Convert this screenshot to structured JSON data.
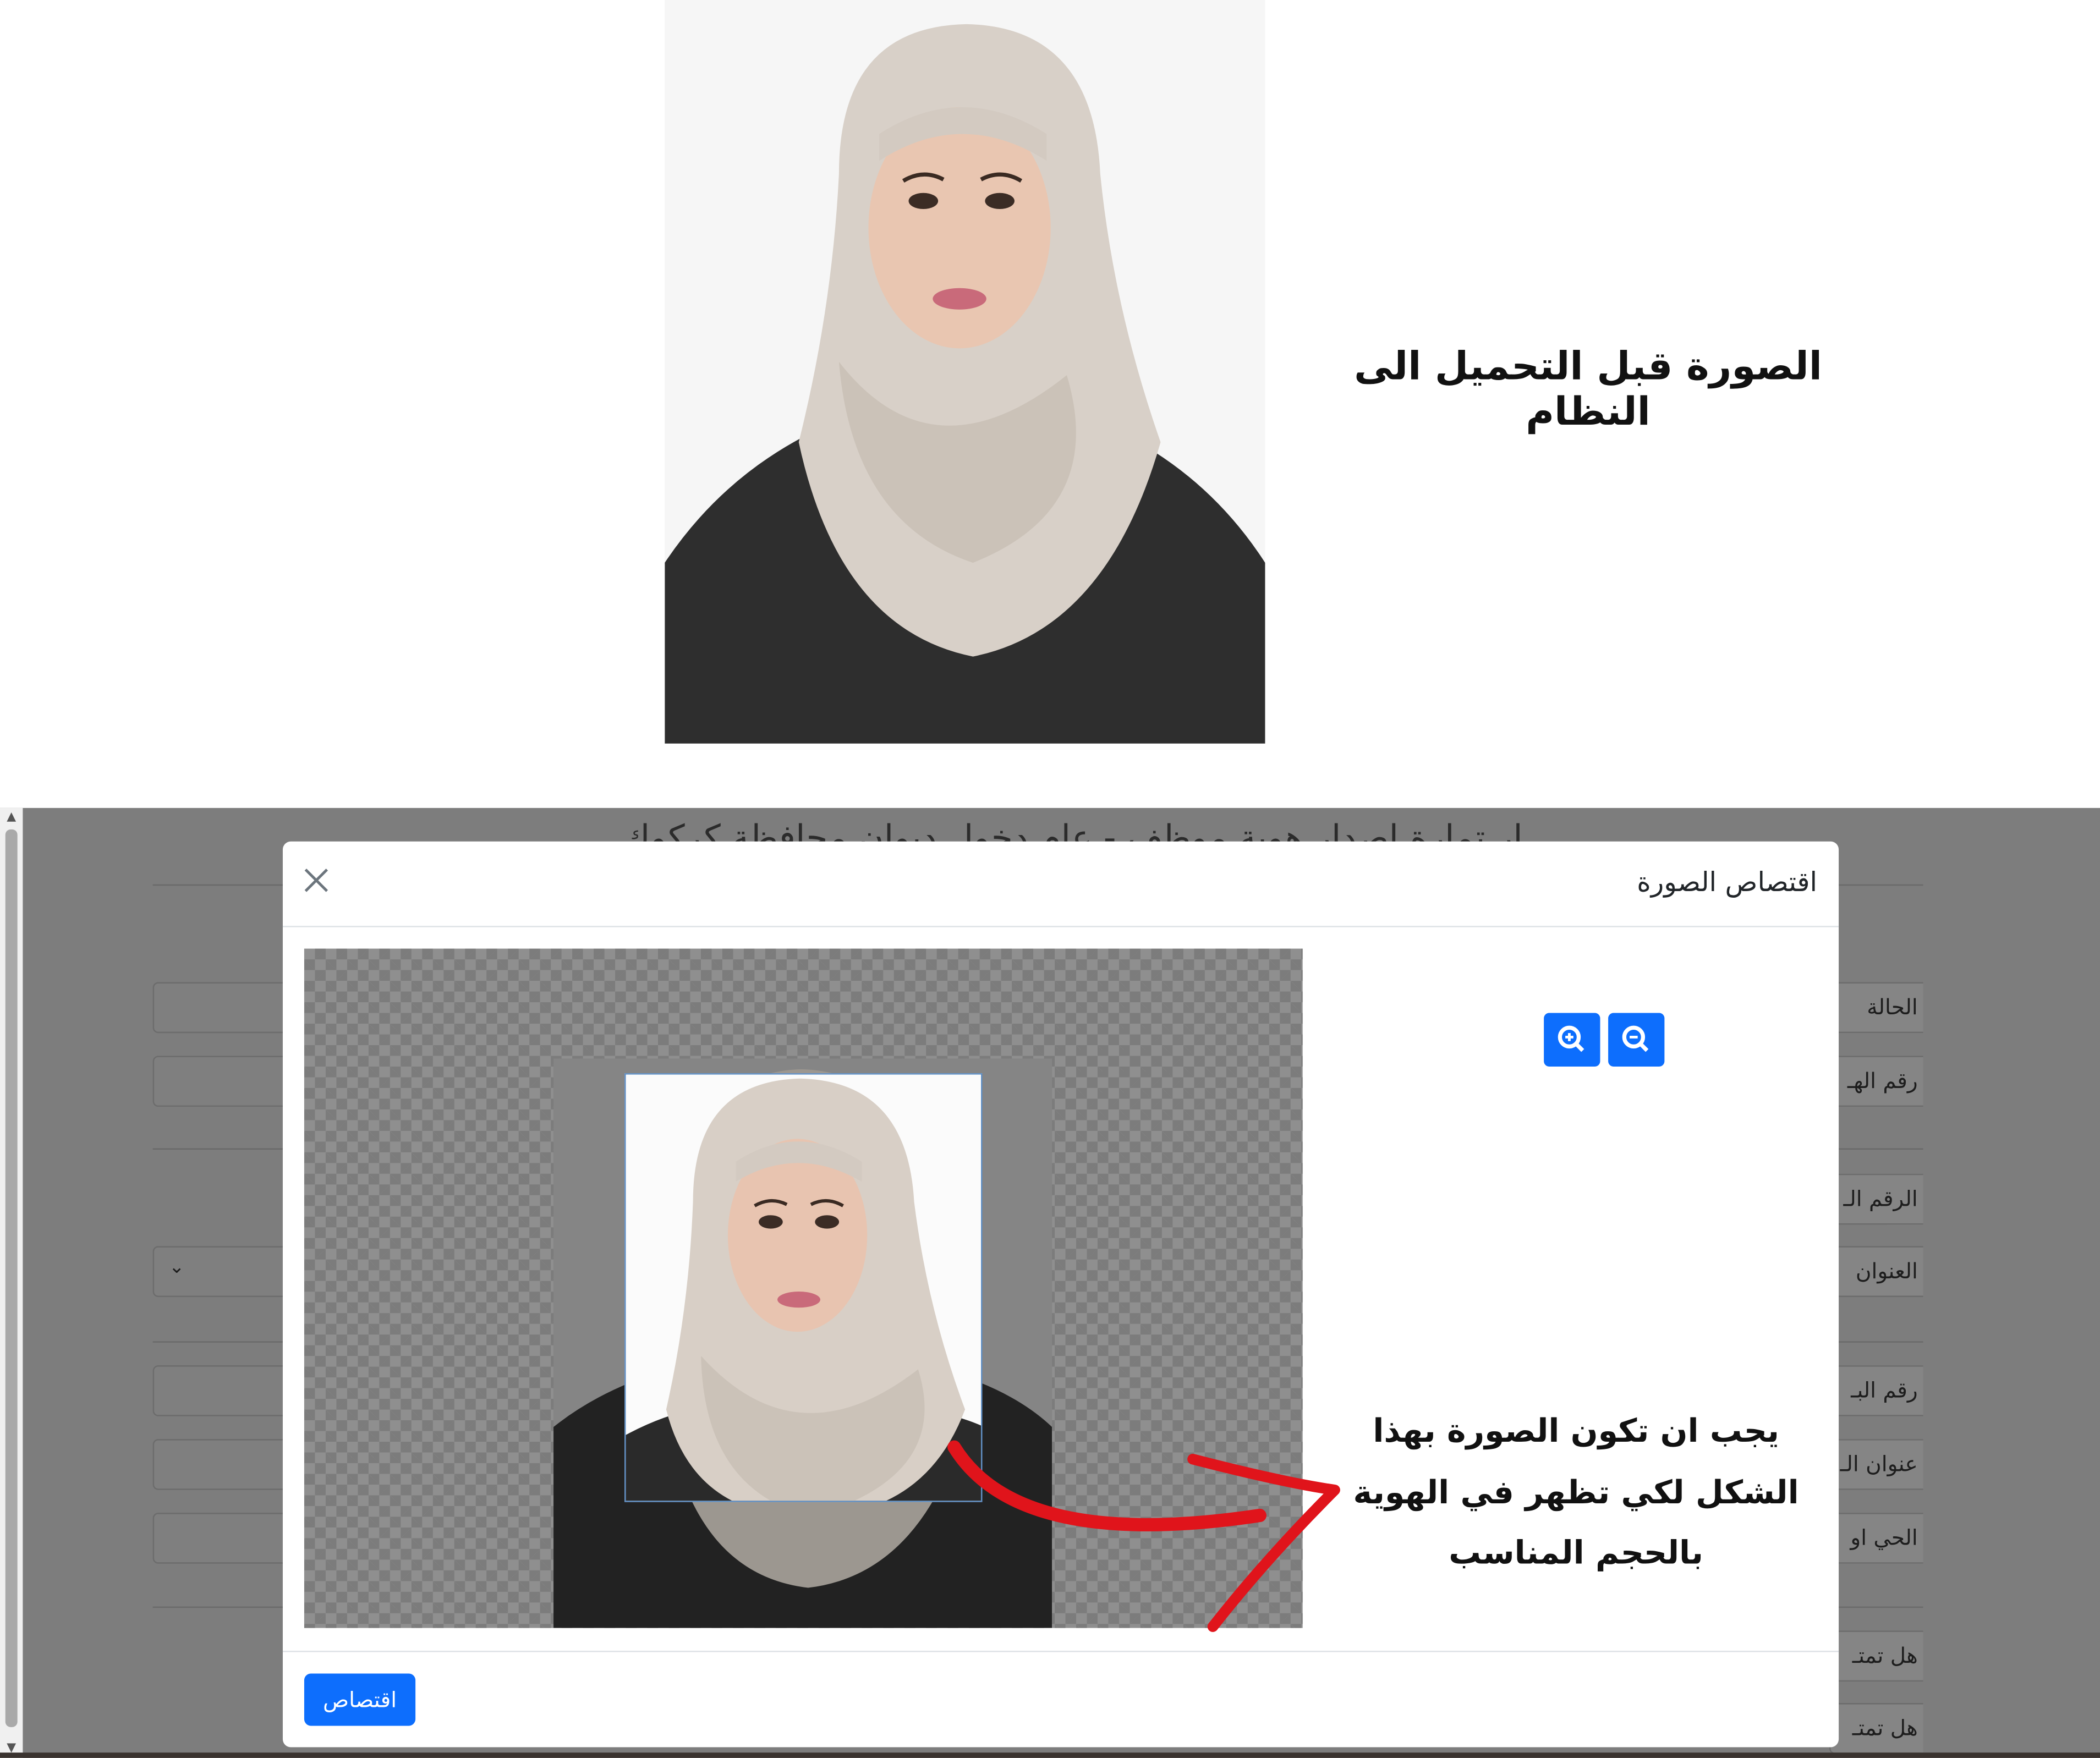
{
  "tutorial": {
    "caption_before": "الصورة قبل التحميل الى النظام"
  },
  "background_page": {
    "title": "ار تمارة اصدار هوية موظف - عام دخول ديوان محافظة كركوك",
    "labels": [
      "الحالة",
      "رقم الهـ",
      "الرقم الـ",
      "العنوان",
      "رقم البـ",
      "عنوان الـ",
      "الحي او",
      "هل تمتـ",
      "هل تمتـ"
    ]
  },
  "modal": {
    "title": "اقتصاص الصورة",
    "close_icon": "close-icon",
    "zoom_in_icon": "zoom-in-icon",
    "zoom_out_icon": "zoom-out-icon",
    "crop_button": "اقتصاص"
  },
  "annotation": {
    "instruction": "يجب ان تكون الصورة بهذا الشكل لكي تظهر في الهوية بالحجم المناسب",
    "arrow_color": "#e0141b"
  },
  "colors": {
    "primary": "#0d6efd",
    "overlay": "#7d7d7d"
  }
}
